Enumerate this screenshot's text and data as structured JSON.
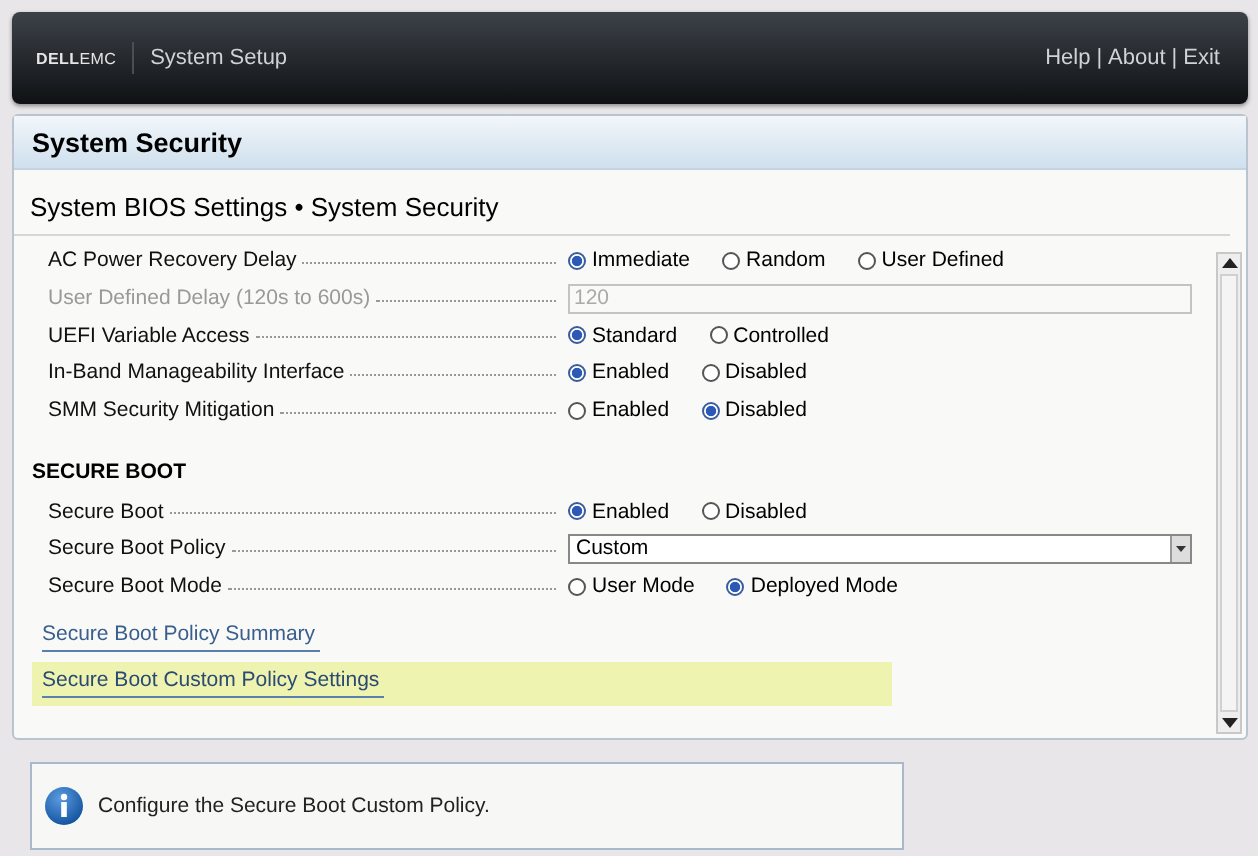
{
  "header": {
    "logo": {
      "brand": "DELL",
      "suffix": "EMC"
    },
    "title": "System Setup",
    "links": [
      {
        "label": "Help"
      },
      {
        "label": "About"
      },
      {
        "label": "Exit"
      }
    ],
    "separators": [
      "|",
      "|"
    ]
  },
  "panel": {
    "title": "System Security",
    "breadcrumb": "System BIOS Settings • System Security"
  },
  "groups": [
    {
      "rows": [
        {
          "kind": "radio",
          "label": "AC Power Recovery Delay",
          "disabled": false,
          "options": [
            {
              "label": "Immediate",
              "selected": true
            },
            {
              "label": "Random",
              "selected": false
            },
            {
              "label": "User Defined",
              "selected": false
            }
          ]
        },
        {
          "kind": "text",
          "label": "User Defined Delay (120s to 600s)",
          "disabled": true,
          "value": "120"
        },
        {
          "kind": "radio",
          "label": "UEFI Variable Access",
          "disabled": false,
          "options": [
            {
              "label": "Standard",
              "selected": true
            },
            {
              "label": "Controlled",
              "selected": false
            }
          ]
        },
        {
          "kind": "radio",
          "label": "In-Band Manageability Interface",
          "disabled": false,
          "options": [
            {
              "label": "Enabled",
              "selected": true
            },
            {
              "label": "Disabled",
              "selected": false
            }
          ]
        },
        {
          "kind": "radio",
          "label": "SMM Security Mitigation",
          "disabled": false,
          "options": [
            {
              "label": "Enabled",
              "selected": false
            },
            {
              "label": "Disabled",
              "selected": true
            }
          ]
        }
      ]
    },
    {
      "heading": "SECURE BOOT",
      "rows": [
        {
          "kind": "radio",
          "label": "Secure Boot",
          "disabled": false,
          "options": [
            {
              "label": "Enabled",
              "selected": true
            },
            {
              "label": "Disabled",
              "selected": false
            }
          ]
        },
        {
          "kind": "dropdown",
          "label": "Secure Boot Policy",
          "disabled": false,
          "value": "Custom"
        },
        {
          "kind": "radio",
          "label": "Secure Boot Mode",
          "disabled": false,
          "options": [
            {
              "label": "User Mode",
              "selected": false
            },
            {
              "label": "Deployed Mode",
              "selected": true
            }
          ]
        }
      ]
    }
  ],
  "links": [
    {
      "label": "Secure Boot Policy Summary",
      "selected": false
    },
    {
      "label": "Secure Boot Custom Policy Settings",
      "selected": true
    }
  ],
  "info": {
    "text": "Configure the Secure Boot Custom Policy."
  }
}
